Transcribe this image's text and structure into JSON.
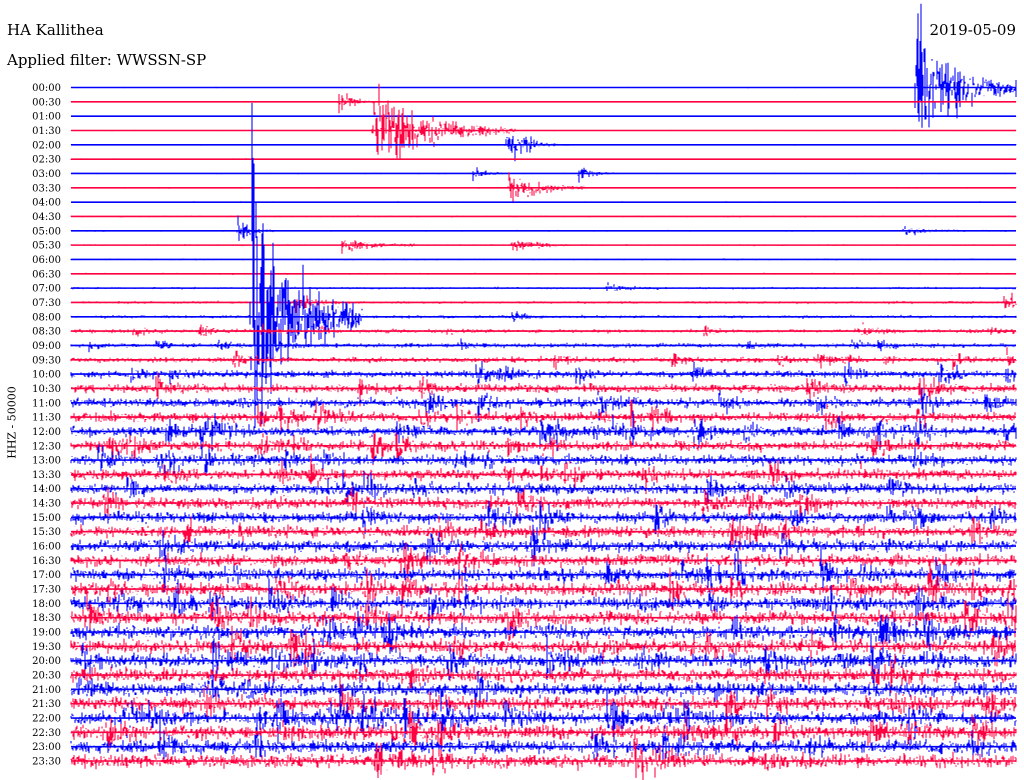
{
  "header": {
    "station": "HA Kallithea",
    "date": "2019-05-09",
    "filter_text": "Applied filter: WWSSN-SP"
  },
  "chart_data": {
    "type": "helicorder",
    "title": "HA Kallithea",
    "date": "2019-05-09",
    "filter": "WWSSN-SP",
    "ylabel": "HHZ - 50000",
    "xlabel": "",
    "minutes_per_line": 30,
    "row_labels": [
      "00:00",
      "00:30",
      "01:00",
      "01:30",
      "02:00",
      "02:30",
      "03:00",
      "03:30",
      "04:00",
      "04:30",
      "05:00",
      "05:30",
      "06:00",
      "06:30",
      "07:00",
      "07:30",
      "08:00",
      "08:30",
      "09:00",
      "09:30",
      "10:00",
      "10:30",
      "11:00",
      "11:30",
      "12:00",
      "12:30",
      "13:00",
      "13:30",
      "14:00",
      "14:30",
      "15:00",
      "15:30",
      "16:00",
      "16:30",
      "17:00",
      "17:30",
      "18:00",
      "18:30",
      "19:00",
      "19:30",
      "20:00",
      "20:30",
      "21:00",
      "21:30",
      "22:00",
      "22:30",
      "23:00",
      "23:30"
    ],
    "colors": [
      "#0000ff",
      "#ff0040"
    ],
    "noise_level": [
      0.6,
      0.5,
      0.5,
      0.6,
      0.7,
      0.7,
      0.7,
      0.8,
      0.8,
      0.9,
      0.9,
      0.9,
      0.9,
      1.0,
      1.3,
      1.6,
      1.8,
      2.2,
      2.6,
      3.2,
      4.2,
      5.2,
      5.6,
      5.8,
      6.0,
      6.0,
      6.0,
      6.2,
      6.3,
      6.5,
      6.6,
      6.8,
      7.0,
      7.2,
      7.4,
      7.6,
      7.8,
      8.0,
      8.2,
      8.3,
      8.3,
      8.4,
      8.4,
      8.3,
      8.2,
      8.1,
      8.0,
      8.0
    ],
    "events": [
      {
        "row": 0,
        "minute": 26.8,
        "amplitude": 90,
        "duration_min": 1.2
      },
      {
        "row": 1,
        "minute": 8.5,
        "amplitude": 16,
        "duration_min": 0.4
      },
      {
        "row": 3,
        "minute": 9.6,
        "amplitude": 60,
        "duration_min": 1.5
      },
      {
        "row": 4,
        "minute": 14.0,
        "amplitude": 12,
        "duration_min": 0.6
      },
      {
        "row": 4,
        "minute": 13.8,
        "amplitude": 14,
        "duration_min": 0.5
      },
      {
        "row": 6,
        "minute": 12.7,
        "amplitude": 9,
        "duration_min": 0.4
      },
      {
        "row": 6,
        "minute": 16.1,
        "amplitude": 10,
        "duration_min": 0.4
      },
      {
        "row": 7,
        "minute": 13.9,
        "amplitude": 22,
        "duration_min": 0.8
      },
      {
        "row": 10,
        "minute": 5.3,
        "amplitude": 14,
        "duration_min": 0.4
      },
      {
        "row": 10,
        "minute": 26.4,
        "amplitude": 8,
        "duration_min": 0.6
      },
      {
        "row": 11,
        "minute": 8.6,
        "amplitude": 12,
        "duration_min": 0.8
      },
      {
        "row": 11,
        "minute": 14.0,
        "amplitude": 10,
        "duration_min": 0.6
      },
      {
        "row": 14,
        "minute": 17.0,
        "amplitude": 6,
        "duration_min": 0.6
      },
      {
        "row": 15,
        "minute": 7.1,
        "amplitude": 10,
        "duration_min": 0.5
      },
      {
        "row": 15,
        "minute": 29.6,
        "amplitude": 14,
        "duration_min": 0.5
      },
      {
        "row": 16,
        "minute": 5.7,
        "amplitude": 200,
        "duration_min": 1.2
      },
      {
        "row": 16,
        "minute": 14.0,
        "amplitude": 7,
        "duration_min": 0.4
      },
      {
        "row": 17,
        "minute": 24.9,
        "amplitude": 8,
        "duration_min": 0.4
      }
    ]
  }
}
